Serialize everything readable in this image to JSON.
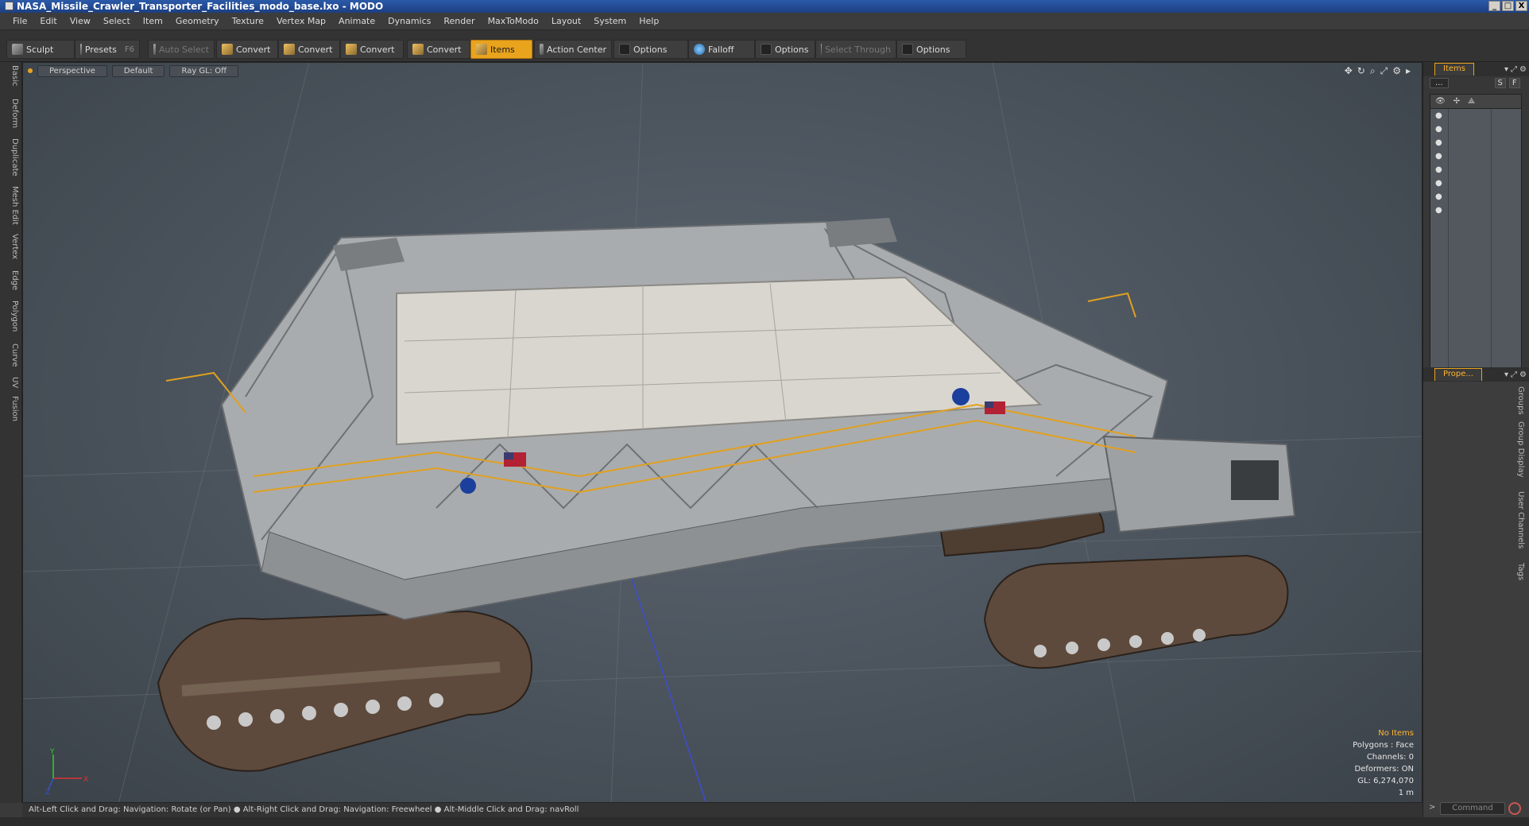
{
  "window": {
    "title": "NASA_Missile_Crawler_Transporter_Facilities_modo_base.lxo - MODO",
    "controls": [
      "_",
      "□",
      "X"
    ]
  },
  "menu": [
    "File",
    "Edit",
    "View",
    "Select",
    "Item",
    "Geometry",
    "Texture",
    "Vertex Map",
    "Animate",
    "Dynamics",
    "Render",
    "MaxToModo",
    "Layout",
    "System",
    "Help"
  ],
  "toolbar": {
    "sculpt": "Sculpt",
    "presets": "Presets",
    "presets_key": "F6",
    "auto_select": "Auto Select",
    "convert1": "Convert",
    "convert2": "Convert",
    "convert3": "Convert",
    "convert4": "Convert",
    "items": "Items",
    "action_center": "Action Center",
    "options1": "Options",
    "falloff": "Falloff",
    "options2": "Options",
    "select_through": "Select Through",
    "options3": "Options"
  },
  "left_tabs": [
    "Basic",
    "Deform",
    "Duplicate",
    "Mesh Edit",
    "Vertex",
    "Edge",
    "Polygon",
    "Curve",
    "UV",
    "Fusion"
  ],
  "viewport": {
    "view": "Perspective",
    "shading": "Default",
    "raygl": "Ray GL: Off",
    "info": {
      "selection": "No Items",
      "polygons": "Polygons : Face",
      "channels": "Channels: 0",
      "deformers": "Deformers: ON",
      "gl": "GL: 6,274,070",
      "scale": "1 m"
    },
    "axes": {
      "x": "X",
      "y": "Y",
      "z": "Z"
    }
  },
  "status": "Alt-Left Click and Drag: Navigation: Rotate (or Pan) ● Alt-Right Click and Drag: Navigation: Freewheel ● Alt-Middle Click and Drag: navRoll",
  "items_panel": {
    "tab": "Items",
    "dropdown": "...",
    "btn_s": "S",
    "btn_f": "F",
    "row_count": 8
  },
  "properties_panel": {
    "tab": "Prope...",
    "vtabs": [
      "Groups",
      "Group Display",
      "User Channels",
      "Tags"
    ]
  },
  "command": {
    "placeholder": "Command",
    "arrow": ">"
  },
  "colors": {
    "accent": "#e9a31d",
    "accent_text": "#ffb52e",
    "viewport_bg": "#4f5861"
  }
}
